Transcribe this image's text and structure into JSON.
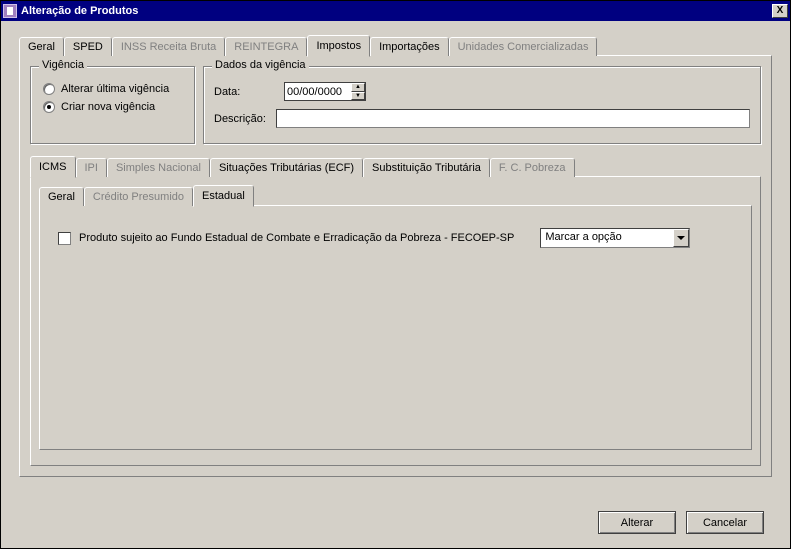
{
  "window": {
    "title": "Alteração de Produtos",
    "close_label": "X"
  },
  "tabs_main": {
    "geral": "Geral",
    "sped": "SPED",
    "inss": "INSS Receita Bruta",
    "reintegra": "REINTEGRA",
    "impostos": "Impostos",
    "importacoes": "Importações",
    "unidades": "Unidades Comercializadas"
  },
  "vigencia": {
    "legend": "Vigência",
    "alterar": "Alterar última vigência",
    "criar": "Criar nova vigência",
    "selected": "criar"
  },
  "dados": {
    "legend": "Dados da vigência",
    "data_label": "Data:",
    "data_value": "00/00/0000",
    "descricao_label": "Descrição:",
    "descricao_value": ""
  },
  "tabs_inner": {
    "icms": "ICMS",
    "ipi": "IPI",
    "simples": "Simples Nacional",
    "situacoes": "Situações Tributárias (ECF)",
    "substituicao": "Substituição Tributária",
    "fcpobreza": "F. C. Pobreza"
  },
  "tabs_inner2": {
    "geral": "Geral",
    "credito": "Crédito Presumido",
    "estadual": "Estadual"
  },
  "estadual": {
    "checkbox_label": "Produto sujeito ao Fundo Estadual de Combate e Erradicação da Pobreza - FECOEP-SP",
    "dropdown_value": "Marcar a opção"
  },
  "buttons": {
    "alterar": "Alterar",
    "cancelar": "Cancelar"
  }
}
